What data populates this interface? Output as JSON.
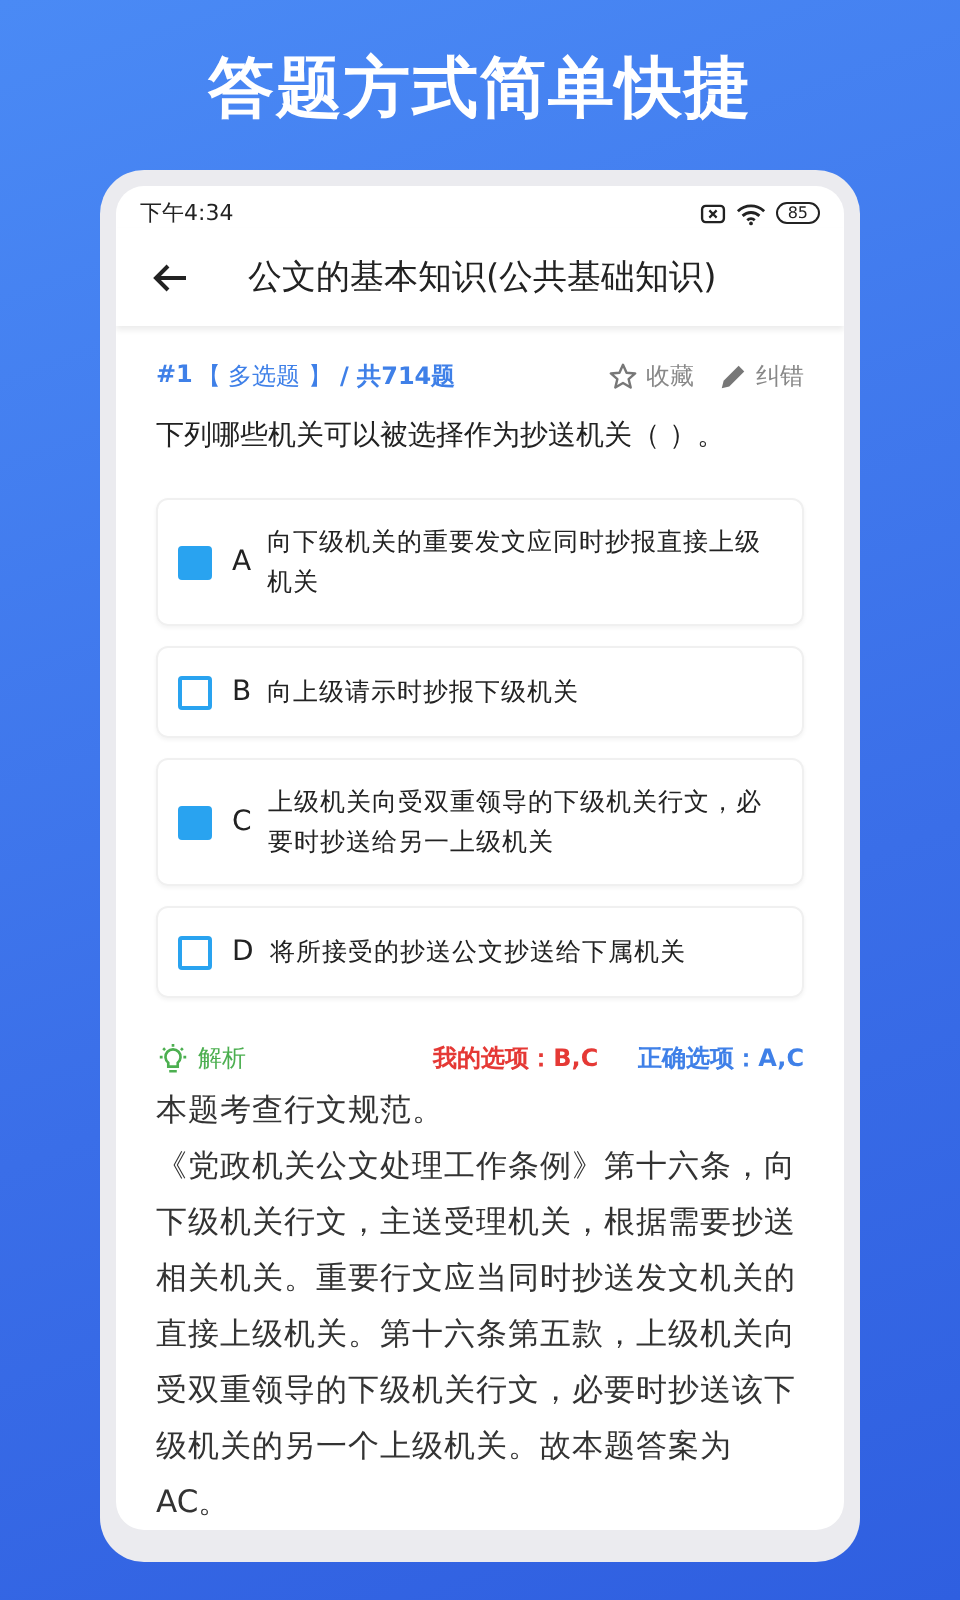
{
  "headline": "答题方式简单快捷",
  "status_bar": {
    "time": "下午4:34",
    "battery": "85"
  },
  "app_bar": {
    "title": "公文的基本知识(公共基础知识)"
  },
  "question": {
    "number": "#1",
    "type": "【 多选题 】",
    "total": "/ 共714题",
    "favorite": "收藏",
    "report": "纠错",
    "text": "下列哪些机关可以被选择作为抄送机关（   ）。"
  },
  "options": [
    {
      "letter": "A",
      "text": "向下级机关的重要发文应同时抄报直接上级机关",
      "checked": true
    },
    {
      "letter": "B",
      "text": "向上级请示时抄报下级机关",
      "checked": false
    },
    {
      "letter": "C",
      "text": "上级机关向受双重领导的下级机关行文，必要时抄送给另一上级机关",
      "checked": true
    },
    {
      "letter": "D",
      "text": "将所接受的抄送公文抄送给下属机关",
      "checked": false
    }
  ],
  "analysis": {
    "label": "解析",
    "my_answer": "我的选项：B,C",
    "correct_answer": "正确选项：A,C",
    "paragraphs": [
      "本题考查行文规范。",
      "《党政机关公文处理工作条例》第十六条，向下级机关行文，主送受理机关，根据需要抄送相关机关。重要行文应当同时抄送发文机关的直接上级机关。第十六条第五款，上级机关向受双重领导的下级机关行文，必要时抄送该下级机关的另一个上级机关。故本题答案为AC。"
    ]
  }
}
